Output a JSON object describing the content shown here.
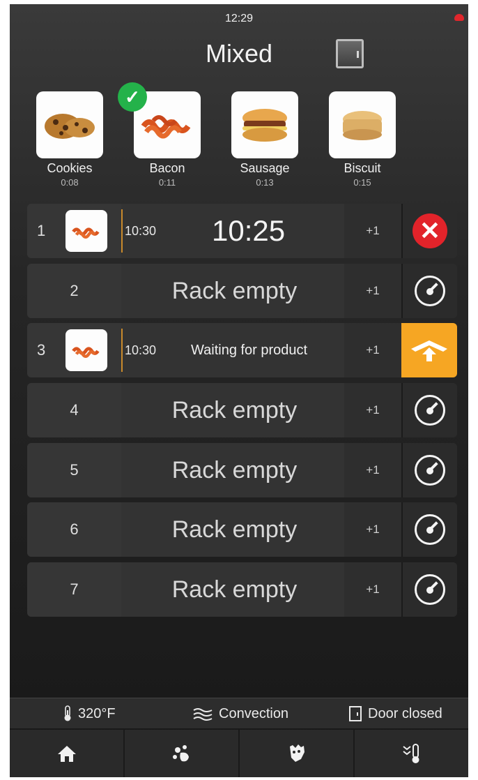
{
  "header": {
    "clock": "12:29",
    "title": "Mixed"
  },
  "products": [
    {
      "name": "Cookies",
      "time": "0:08",
      "icon": "cookies-image"
    },
    {
      "name": "Bacon",
      "time": "0:11",
      "icon": "bacon-image",
      "selected": true
    },
    {
      "name": "Sausage",
      "time": "0:13",
      "icon": "sausage-sandwich-image"
    },
    {
      "name": "Biscuit",
      "time": "0:15",
      "icon": "biscuit-image"
    }
  ],
  "racks": [
    {
      "number": "1",
      "product_icon": "bacon-image",
      "set_time": "10:30",
      "countdown": "10:25",
      "plus": "+1",
      "action": "cancel-icon"
    },
    {
      "number": "2",
      "status": "Rack empty",
      "plus": "+1",
      "action": "timer-icon"
    },
    {
      "number": "3",
      "product_icon": "bacon-image",
      "set_time": "10:30",
      "status": "Waiting for product",
      "plus": "+1",
      "action": "unload-icon"
    },
    {
      "number": "4",
      "status": "Rack empty",
      "plus": "+1",
      "action": "timer-icon"
    },
    {
      "number": "5",
      "status": "Rack empty",
      "plus": "+1",
      "action": "timer-icon"
    },
    {
      "number": "6",
      "status": "Rack empty",
      "plus": "+1",
      "action": "timer-icon"
    },
    {
      "number": "7",
      "status": "Rack empty",
      "plus": "+1",
      "action": "timer-icon"
    }
  ],
  "status_bar": {
    "temperature": "320°F",
    "mode": "Convection",
    "door": "Door closed"
  },
  "nav": [
    "home-icon",
    "clean-icon",
    "hand-wash-icon",
    "cool-down-icon"
  ],
  "colors": {
    "accent_orange": "#f6a623",
    "cancel_red": "#e2232a",
    "check_green": "#24b24a",
    "progress_line": "#c98a2b"
  }
}
